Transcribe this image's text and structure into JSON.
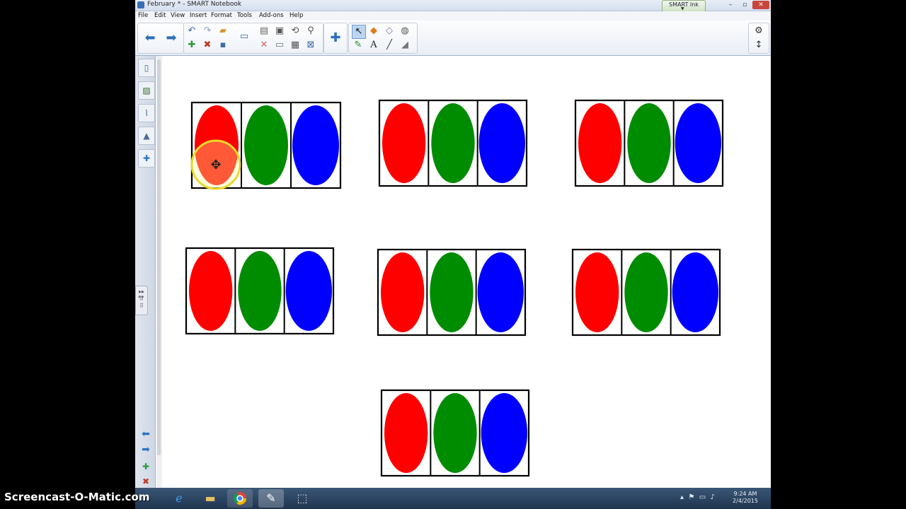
{
  "window": {
    "title": "February * - SMART Notebook",
    "ink_badge": "SMART Ink",
    "controls": [
      "–",
      "▫",
      "✕"
    ]
  },
  "menu": [
    "File",
    "Edit",
    "View",
    "Insert",
    "Format",
    "Tools",
    "Add-ons",
    "Help"
  ],
  "toolbar": {
    "icons": [
      "back-icon",
      "forward-icon",
      "undo-icon",
      "redo-icon",
      "open-icon",
      "screen-shade-icon",
      "paste-icon",
      "insert-picture-icon",
      "rotate-icon",
      "magnifier-icon",
      "add-page-icon",
      "delete-page-icon",
      "save-icon",
      "delete-icon",
      "table-icon",
      "close-icon",
      "puzzle-icon",
      "select-icon",
      "shapes-icon",
      "eraser-icon",
      "fill-icon",
      "pens-icon",
      "text-icon",
      "line-icon",
      "eraser2-icon",
      "settings-icon",
      "move-toolbar-icon"
    ]
  },
  "sidepanel": {
    "tabs": [
      "page-sorter-icon",
      "gallery-icon",
      "attachments-icon",
      "properties-icon",
      "addons-icon"
    ]
  },
  "chart_data": {
    "type": "table",
    "description": "Red-green-blue repeating pattern frames",
    "colors": {
      "red": "#ff0000",
      "green": "#008c00",
      "blue": "#0000ff"
    },
    "rows": [
      [
        "red",
        "green",
        "blue"
      ],
      [
        "red",
        "green",
        "blue"
      ],
      [
        "red",
        "green",
        "blue"
      ],
      [
        "red",
        "green",
        "blue"
      ],
      [
        "red",
        "green",
        "blue"
      ],
      [
        "red",
        "green",
        "blue"
      ],
      [
        "red",
        "green",
        "blue"
      ]
    ]
  },
  "taskbar": {
    "clock_time": "9:24 AM",
    "clock_date": "2/4/2015"
  },
  "watermark": "Screencast-O-Matic.com"
}
